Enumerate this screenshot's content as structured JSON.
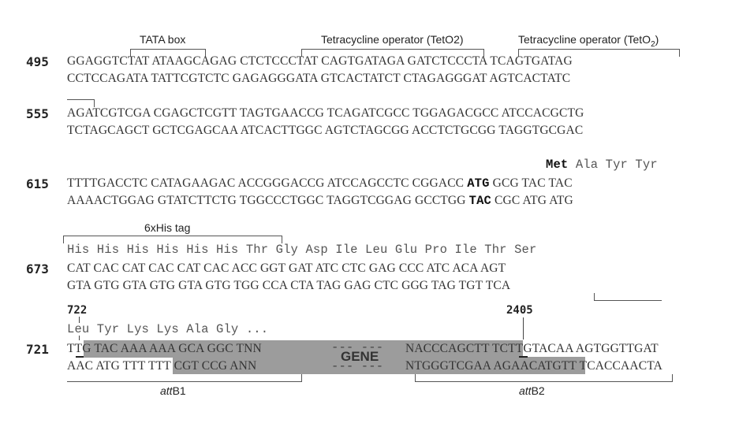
{
  "annotations": {
    "tata_box": "TATA box",
    "teto2_1": "Tetracycline operator (TetO2)",
    "teto2_2_prefix": "Tetracycline operator (TetO",
    "teto2_2_sub": "2",
    "teto2_2_suffix": ")",
    "his_tag": "6xHis tag",
    "attb1_italic": "att",
    "attb1_rest": "B1",
    "attb2_italic": "att",
    "attb2_rest": "B2",
    "gene": "GENE",
    "pos_722": "722",
    "pos_2405": "2405"
  },
  "rows": [
    {
      "number": "495",
      "top": "GGAGGTCTAT ATAAGCAGAG CTCTCCCTAT CAGTGATAGA GATCTCCCTA TCAGTGATAG",
      "bottom": "CCTCCAGATA TATTCGTCTC GAGAGGGATA GTCACTATCT CTAGAGGGAT AGTCACTATC"
    },
    {
      "number": "555",
      "top": "AGATCGTCGA CGAGCTCGTT TAGTGAACCG TCAGATCGCC TGGAGACGCC ATCCACGCTG",
      "bottom": "TCTAGCAGCT GCTCGAGCAA ATCACTTGGC AGTCTAGCGG ACCTCTGCGG TAGGTGCGAC"
    },
    {
      "number": "615",
      "aa_bold": "Met",
      "aa_rest": "Ala Tyr Tyr",
      "top_pre": "TTTTGACCTC CATAGAAGAC ACCGGGACCG ATCCAGCCTC CGGACC",
      "top_bold": "ATG",
      "top_post": "GCG TAC TAC",
      "bottom_pre": "AAAACTGGAG GTATCTTCTG TGGCCCTGGC TAGGTCGGAG GCCTGG",
      "bottom_bold": "TAC",
      "bottom_post": "CGC ATG ATG"
    },
    {
      "number": "673",
      "aa": "His His His His His His Thr Gly Asp Ile Leu Glu Pro Ile Thr Ser",
      "top": "CAT CAC CAT CAC CAT CAC ACC GGT GAT ATC CTC GAG CCC ATC ACA AGT",
      "bottom": "GTA GTG GTA GTG GTA GTG TGG CCA CTA TAG GAG CTC GGG TAG TGT TCA"
    },
    {
      "number": "721",
      "aa": "Leu Tyr Lys Lys Ala Gly ...",
      "top_left": "TTG TAC AAA AAA GCA GGC TNN",
      "top_dash": "--- ---",
      "top_right": "NACCCAGCTT TCTTGTACAA AGTGGTTGAT",
      "bottom_left": "AAC ATG TTT TTT CGT CCG ANN",
      "bottom_dash": "--- ---",
      "bottom_right": "NTGGGTCGAA AGAACATGTT TCACCAACTA"
    }
  ],
  "colors": {
    "highlight": "#9c9c9c",
    "bracket": "#555555"
  }
}
